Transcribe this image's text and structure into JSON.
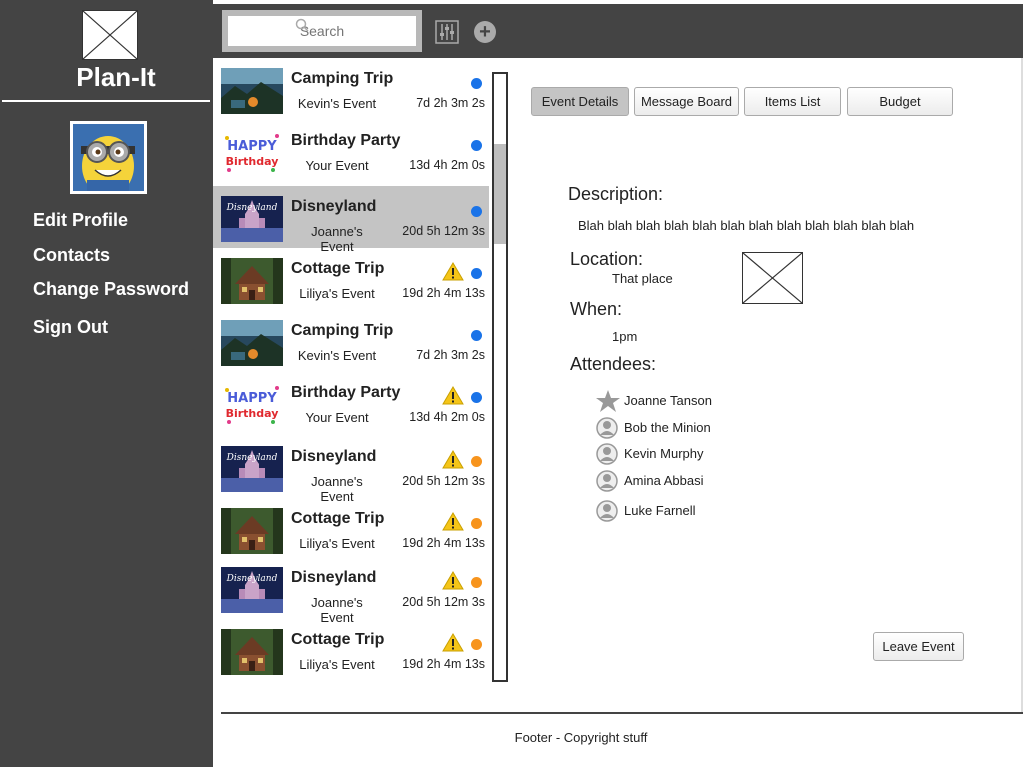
{
  "sidebar": {
    "app_title": "Plan-It",
    "nav": [
      "Edit Profile",
      "Contacts",
      "Change Password",
      "Sign Out"
    ]
  },
  "topbar": {
    "search_placeholder": "Search"
  },
  "events": [
    {
      "name": "Camping Trip",
      "owner": "Kevin's Event",
      "time": "7d 2h 3m 2s",
      "thumb": "camping",
      "status": "blue",
      "warning": false,
      "selected": false
    },
    {
      "name": "Birthday Party",
      "owner": "Your Event",
      "time": "13d 4h 2m 0s",
      "thumb": "birthday",
      "status": "blue",
      "warning": false,
      "selected": false
    },
    {
      "name": "Disneyland",
      "owner": "Joanne's Event",
      "time": "20d 5h 12m 3s",
      "thumb": "disneyland",
      "status": "blue",
      "warning": false,
      "selected": true
    },
    {
      "name": "Cottage Trip",
      "owner": "Liliya's Event",
      "time": "19d 2h 4m 13s",
      "thumb": "cottage",
      "status": "blue",
      "warning": true,
      "selected": false
    },
    {
      "name": "Camping Trip",
      "owner": "Kevin's Event",
      "time": "7d 2h 3m 2s",
      "thumb": "camping",
      "status": "blue",
      "warning": false,
      "selected": false
    },
    {
      "name": "Birthday Party",
      "owner": "Your Event",
      "time": "13d 4h 2m 0s",
      "thumb": "birthday",
      "status": "blue",
      "warning": true,
      "selected": false
    },
    {
      "name": "Disneyland",
      "owner": "Joanne's Event",
      "time": "20d 5h 12m 3s",
      "thumb": "disneyland",
      "status": "orange",
      "warning": true,
      "selected": false
    },
    {
      "name": "Cottage Trip",
      "owner": "Liliya's Event",
      "time": "19d 2h 4m 13s",
      "thumb": "cottage",
      "status": "orange",
      "warning": true,
      "selected": false
    },
    {
      "name": "Disneyland",
      "owner": "Joanne's Event",
      "time": "20d 5h 12m 3s",
      "thumb": "disneyland",
      "status": "orange",
      "warning": true,
      "selected": false
    },
    {
      "name": "Cottage Trip",
      "owner": "Liliya's Event",
      "time": "19d 2h 4m 13s",
      "thumb": "cottage",
      "status": "orange",
      "warning": true,
      "selected": false
    }
  ],
  "tabs": [
    {
      "label": "Event Details",
      "active": true
    },
    {
      "label": "Message Board",
      "active": false
    },
    {
      "label": "Items List",
      "active": false
    },
    {
      "label": "Budget",
      "active": false
    }
  ],
  "details": {
    "description_label": "Description:",
    "description": "Blah blah blah blah blah blah blah blah blah blah blah blah",
    "location_label": "Location:",
    "location": "That place",
    "when_label": "When:",
    "when": "1pm",
    "attendees_label": "Attendees:",
    "attendees": [
      {
        "name": "Joanne Tanson",
        "icon": "star-icon"
      },
      {
        "name": "Bob the Minion",
        "icon": "user-icon"
      },
      {
        "name": "Kevin Murphy",
        "icon": "user-icon"
      },
      {
        "name": "Amina Abbasi",
        "icon": "user-icon"
      },
      {
        "name": "Luke Farnell",
        "icon": "user-icon"
      }
    ]
  },
  "leave_button": "Leave Event",
  "footer": "Footer - Copyright stuff",
  "colors": {
    "sidebar": "#444444",
    "status_blue": "#1a73e8",
    "status_orange": "#f7941d",
    "warning": "#f5c518",
    "selected_row": "#c4c4c4"
  }
}
